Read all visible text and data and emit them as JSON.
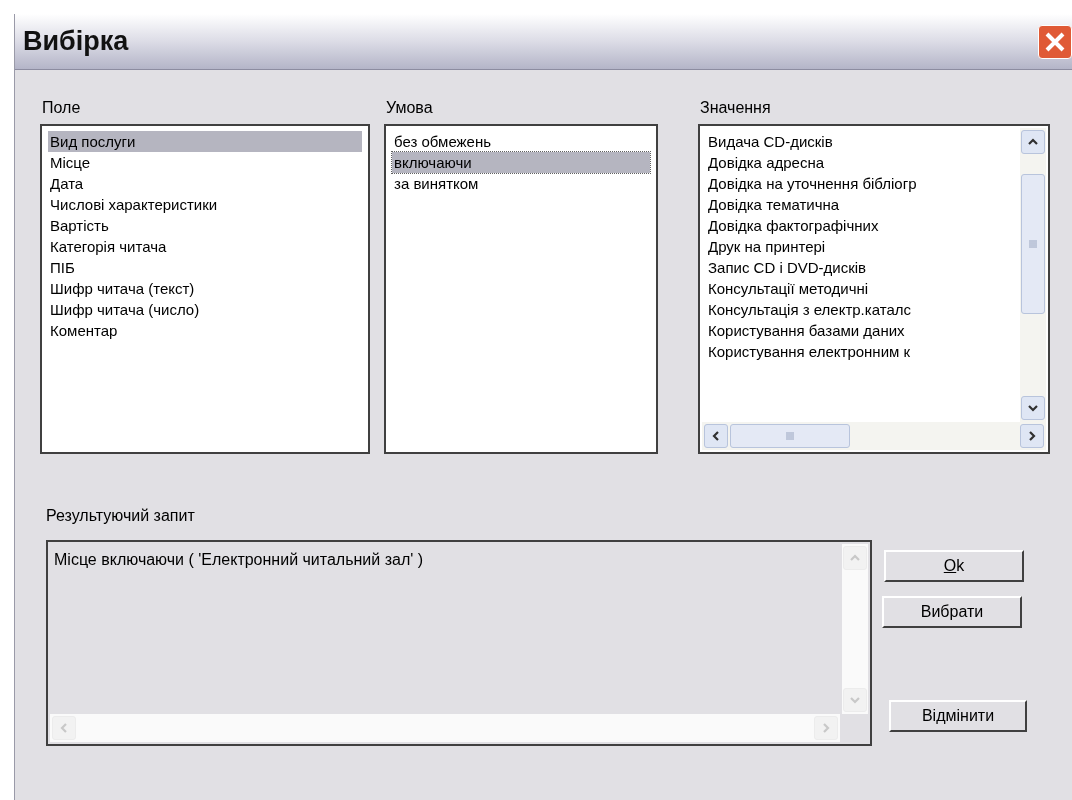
{
  "window": {
    "title": "Вибірка"
  },
  "lists": [
    {
      "label": "Поле",
      "scrollbars": false,
      "items": [
        {
          "text": "Вид послуги",
          "selected": true,
          "focused": false
        },
        {
          "text": "Місце",
          "selected": false,
          "focused": false
        },
        {
          "text": "Дата",
          "selected": false,
          "focused": false
        },
        {
          "text": "Числові характеристики",
          "selected": false,
          "focused": false
        },
        {
          "text": "Вартість",
          "selected": false,
          "focused": false
        },
        {
          "text": "Категорія читача",
          "selected": false,
          "focused": false
        },
        {
          "text": "ПІБ",
          "selected": false,
          "focused": false
        },
        {
          "text": "Шифр читача (текст)",
          "selected": false,
          "focused": false
        },
        {
          "text": "Шифр читача (число)",
          "selected": false,
          "focused": false
        },
        {
          "text": "Коментар",
          "selected": false,
          "focused": false
        }
      ]
    },
    {
      "label": "Умова",
      "scrollbars": false,
      "items": [
        {
          "text": "без обмежень",
          "selected": false,
          "focused": false
        },
        {
          "text": "включаючи",
          "selected": true,
          "focused": true
        },
        {
          "text": "за винятком",
          "selected": false,
          "focused": false
        }
      ]
    },
    {
      "label": "Значення",
      "scrollbars": true,
      "items": [
        {
          "text": "Видача CD-дисків",
          "selected": false,
          "focused": false
        },
        {
          "text": "Довідка адресна",
          "selected": false,
          "focused": false
        },
        {
          "text": "Довідка на уточнення бібліогр",
          "selected": false,
          "focused": false
        },
        {
          "text": "Довідка тематична",
          "selected": false,
          "focused": false
        },
        {
          "text": "Довідка фактографічних",
          "selected": false,
          "focused": false
        },
        {
          "text": "Друк на принтері",
          "selected": false,
          "focused": false
        },
        {
          "text": "Запис CD і DVD-дисків",
          "selected": false,
          "focused": false
        },
        {
          "text": "Консультації  методичні",
          "selected": false,
          "focused": false
        },
        {
          "text": "Консультація з електр.каталс",
          "selected": false,
          "focused": false
        },
        {
          "text": "Користування базами даних",
          "selected": false,
          "focused": false
        },
        {
          "text": "Користування електронним к",
          "selected": false,
          "focused": false
        }
      ]
    }
  ],
  "query": {
    "label": "Результуючий запит",
    "value": "Місце включаючи ( 'Електронний читальний зал' )",
    "disabled": true
  },
  "buttons": [
    {
      "label": "Ok",
      "mnemonic": true
    },
    {
      "label": "Вибрати",
      "mnemonic": false
    },
    {
      "label": "Відмінити",
      "mnemonic": false
    }
  ]
}
